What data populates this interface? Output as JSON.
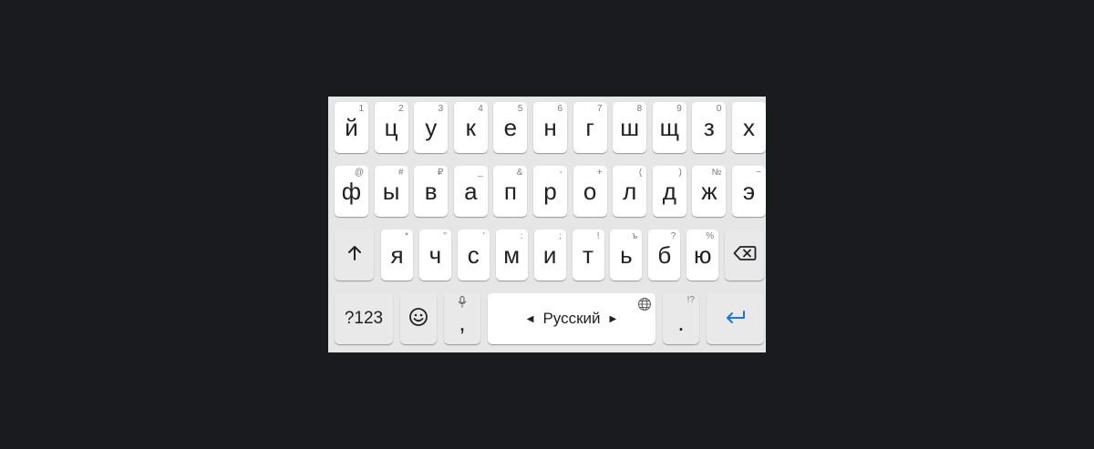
{
  "keyboard": {
    "row1": [
      {
        "char": "й",
        "hint": "1"
      },
      {
        "char": "ц",
        "hint": "2"
      },
      {
        "char": "у",
        "hint": "3"
      },
      {
        "char": "к",
        "hint": "4"
      },
      {
        "char": "е",
        "hint": "5"
      },
      {
        "char": "н",
        "hint": "6"
      },
      {
        "char": "г",
        "hint": "7"
      },
      {
        "char": "ш",
        "hint": "8"
      },
      {
        "char": "щ",
        "hint": "9"
      },
      {
        "char": "з",
        "hint": "0"
      },
      {
        "char": "х",
        "hint": ""
      }
    ],
    "row2": [
      {
        "char": "ф",
        "hint": "@"
      },
      {
        "char": "ы",
        "hint": "#"
      },
      {
        "char": "в",
        "hint": "₽"
      },
      {
        "char": "а",
        "hint": "_"
      },
      {
        "char": "п",
        "hint": "&"
      },
      {
        "char": "р",
        "hint": "-"
      },
      {
        "char": "о",
        "hint": "+"
      },
      {
        "char": "л",
        "hint": "("
      },
      {
        "char": "д",
        "hint": ")"
      },
      {
        "char": "ж",
        "hint": "№"
      },
      {
        "char": "э",
        "hint": "~"
      }
    ],
    "row3": [
      {
        "char": "я",
        "hint": "*"
      },
      {
        "char": "ч",
        "hint": "\""
      },
      {
        "char": "с",
        "hint": "'"
      },
      {
        "char": "м",
        "hint": ":"
      },
      {
        "char": "и",
        "hint": ";"
      },
      {
        "char": "т",
        "hint": "!"
      },
      {
        "char": "ь",
        "hint": "ъ"
      },
      {
        "char": "б",
        "hint": "?"
      },
      {
        "char": "ю",
        "hint": "%"
      }
    ],
    "symbols_label": "?123",
    "comma": ",",
    "space_label": "Русский",
    "period": ".",
    "period_hint": "!?",
    "icons": {
      "shift": "shift-up-arrow-icon",
      "backspace": "backspace-icon",
      "emoji": "smiley-emoji-icon",
      "mic": "microphone-icon",
      "globe": "globe-icon",
      "enter": "enter-return-icon",
      "left": "triangle-left-icon",
      "right": "triangle-right-icon"
    },
    "colors": {
      "background": "#e6e6e6",
      "key": "#ffffff",
      "function_key": "#e9e9e9",
      "enter_accent": "#1a73e8"
    }
  }
}
